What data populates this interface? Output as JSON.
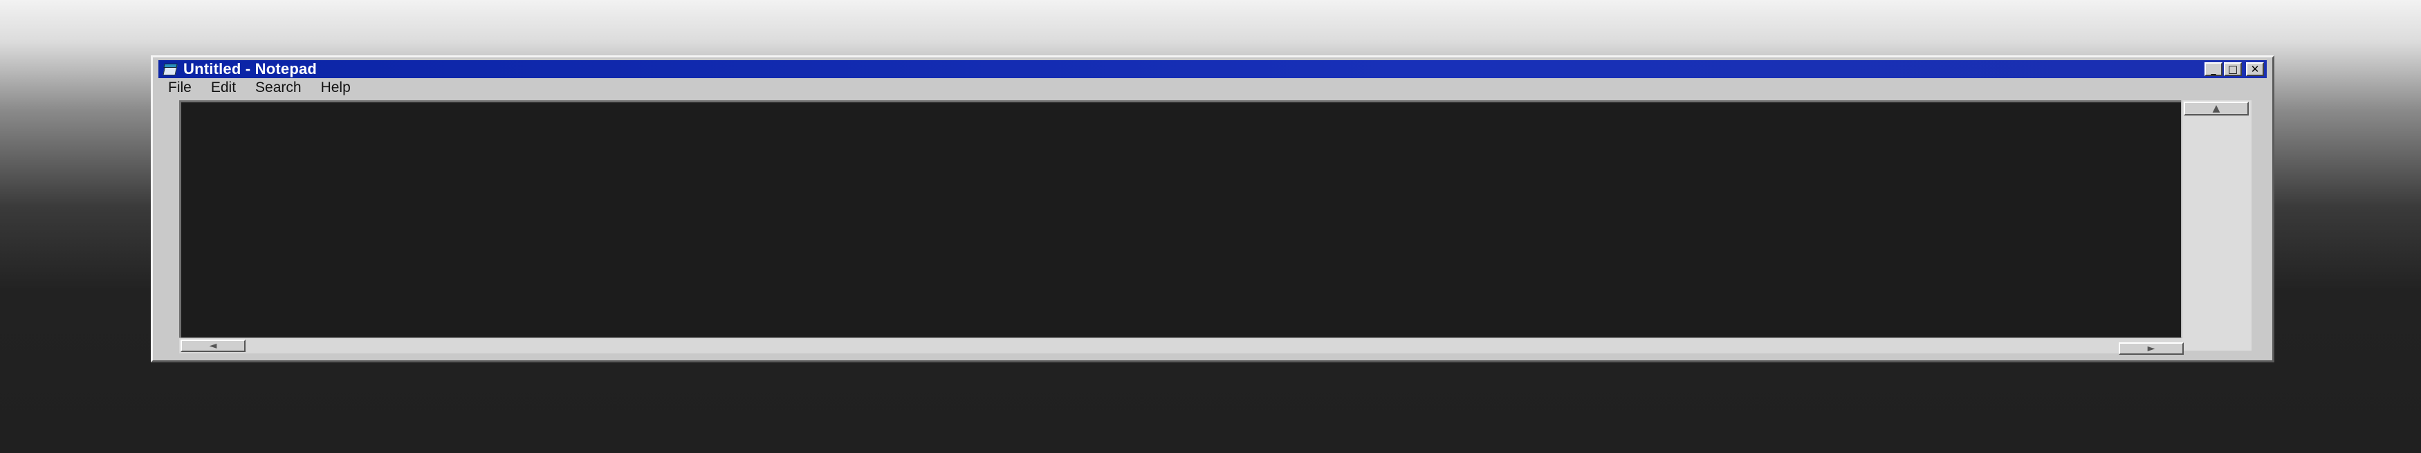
{
  "window": {
    "title": "Untitled - Notepad",
    "controls": {
      "minimize": "_",
      "maximize": "□",
      "close": "✕"
    }
  },
  "menu": [
    "File",
    "Edit",
    "Search",
    "Help"
  ],
  "editor": {
    "content": ""
  },
  "scrollbars": {
    "up_arrow": "▲",
    "left_arrow": "◄",
    "right_arrow": "►"
  },
  "icons": {
    "app": "notepad-icon"
  },
  "colors": {
    "titlebar": "#0b24a6",
    "editor_bg": "#1c1c1c",
    "chrome": "#c9c9c9"
  }
}
